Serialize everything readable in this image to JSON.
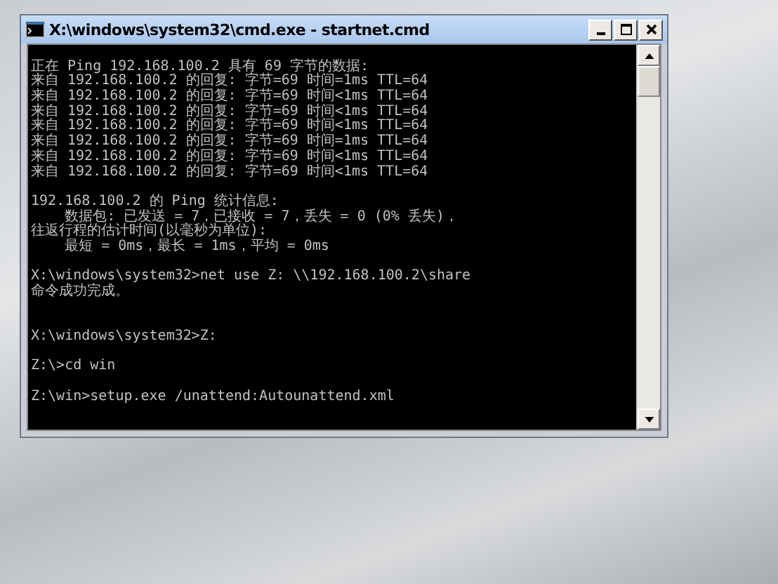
{
  "window": {
    "title": "X:\\windows\\system32\\cmd.exe - startnet.cmd"
  },
  "console": {
    "lines": [
      {
        "kind": "blank"
      },
      {
        "kind": "text",
        "text": "正在 Ping 192.168.100.2 具有 69 字节的数据:"
      },
      {
        "kind": "text",
        "text": "来自 192.168.100.2 的回复: 字节=69 时间=1ms TTL=64"
      },
      {
        "kind": "text",
        "text": "来自 192.168.100.2 的回复: 字节=69 时间<1ms TTL=64"
      },
      {
        "kind": "text",
        "text": "来自 192.168.100.2 的回复: 字节=69 时间<1ms TTL=64"
      },
      {
        "kind": "text",
        "text": "来自 192.168.100.2 的回复: 字节=69 时间<1ms TTL=64"
      },
      {
        "kind": "text",
        "text": "来自 192.168.100.2 的回复: 字节=69 时间=1ms TTL=64"
      },
      {
        "kind": "text",
        "text": "来自 192.168.100.2 的回复: 字节=69 时间<1ms TTL=64"
      },
      {
        "kind": "text",
        "text": "来自 192.168.100.2 的回复: 字节=69 时间<1ms TTL=64"
      },
      {
        "kind": "blank"
      },
      {
        "kind": "text",
        "text": "192.168.100.2 的 Ping 统计信息:"
      },
      {
        "kind": "text",
        "text": "    数据包: 已发送 = 7，已接收 = 7，丢失 = 0 (0% 丢失)，"
      },
      {
        "kind": "text",
        "text": "往返行程的估计时间(以毫秒为单位):"
      },
      {
        "kind": "text",
        "text": "    最短 = 0ms，最长 = 1ms，平均 = 0ms"
      },
      {
        "kind": "blank"
      },
      {
        "kind": "text",
        "text": "X:\\windows\\system32>net use Z: \\\\192.168.100.2\\share"
      },
      {
        "kind": "text",
        "text": "命令成功完成。"
      },
      {
        "kind": "blank"
      },
      {
        "kind": "blank"
      },
      {
        "kind": "text",
        "text": "X:\\windows\\system32>Z:"
      },
      {
        "kind": "blank"
      },
      {
        "kind": "text",
        "text": "Z:\\>cd win"
      },
      {
        "kind": "blank"
      },
      {
        "kind": "text",
        "text": "Z:\\win>setup.exe /unattend:Autounattend.xml"
      }
    ]
  }
}
